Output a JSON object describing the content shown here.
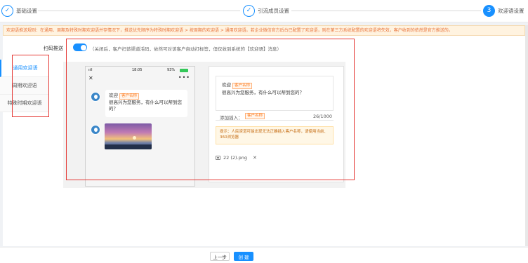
{
  "steps": [
    {
      "index": "1",
      "label": "基础设置",
      "state": "done"
    },
    {
      "index": "2",
      "label": "引流成员设置",
      "state": "done"
    },
    {
      "index": "3",
      "label": "欢迎语设置",
      "state": "active"
    }
  ],
  "notice": "欢迎语推送规则：在通用、周期及特殊时期欢迎语并存情况下，推送优先顺序为特殊时期欢迎语 > 按周期的欢迎语 > 通用欢迎语。若企业微信官方后台已配置了欢迎语，则在第三方系统配置的欢迎语将失效，客户收到的依然是官方推送的。",
  "tabs": [
    "通用欢迎语",
    "周期欢迎语",
    "特殊时期欢迎语"
  ],
  "push": {
    "label": "扫码推送",
    "enabled": true,
    "tip": "（关闭后，客户扫该渠道活码，依然可对该客户自动打标签，但仅收到系统的【欢迎语】消息）"
  },
  "phone": {
    "signal": "ııll",
    "time": "18:05",
    "battery": "93%",
    "close": "✕",
    "more": "•••",
    "message_prefix": "欢迎",
    "message_tag": "客户名称",
    "message_body": "很高兴为您服务，有什么可以帮到您的？"
  },
  "editor": {
    "prefix": "欢迎",
    "tag": "客户名称",
    "body": "很高兴为您服务，有什么可以帮到您的？",
    "insert_label": "添加插入：",
    "insert_tag": "客户名称",
    "counter": "26/1000",
    "hint": "提示：人民资道可能出现无法正确插入客户名称，请使用当前、360浏览器",
    "attachment": "22 (2).png",
    "attachment_remove": "✕"
  },
  "footer": {
    "prev": "上一步",
    "create": "创 建"
  },
  "colors": {
    "accent": "#1890ff",
    "highlight_border": "#e53935",
    "notice": "#e8733a"
  }
}
